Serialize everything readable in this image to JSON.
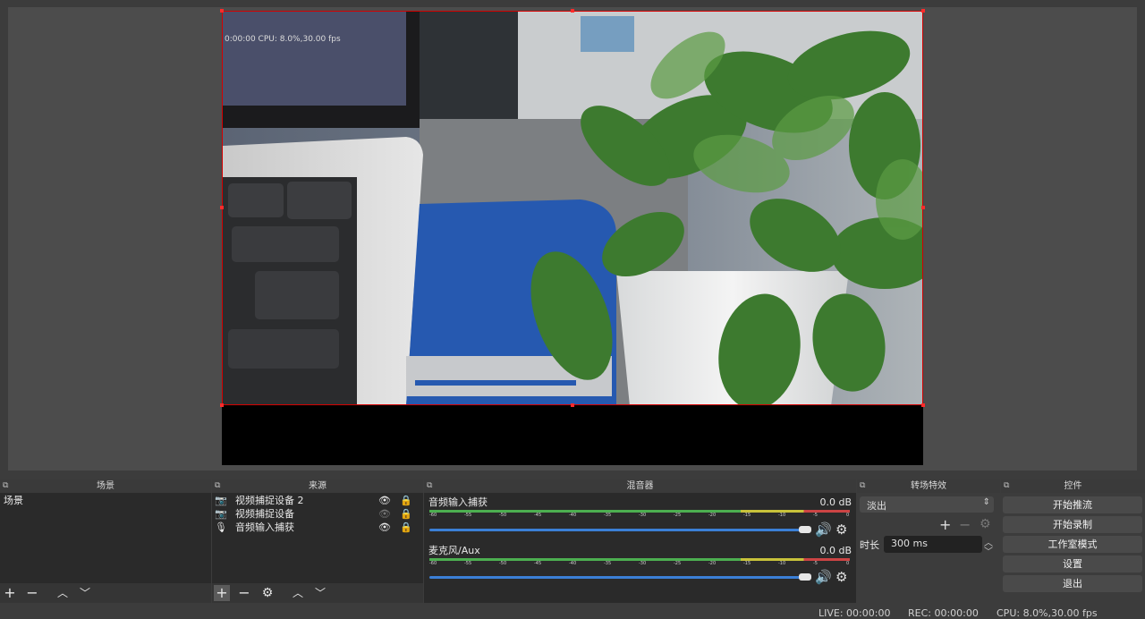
{
  "docks": {
    "scenes": {
      "title": "场景",
      "items": [
        "场景"
      ]
    },
    "sources": {
      "title": "来源",
      "items": [
        {
          "label": "视频捕捉设备 2",
          "icon": "camera-icon",
          "visible": true
        },
        {
          "label": "视频捕捉设备",
          "icon": "camera-icon",
          "visible": false
        },
        {
          "label": "音频输入捕获",
          "icon": "microphone-icon",
          "visible": true
        }
      ]
    },
    "mixer": {
      "title": "混音器",
      "channels": [
        {
          "name": "音频输入捕获",
          "level": "0.0 dB"
        },
        {
          "name": "麦克风/Aux",
          "level": "0.0 dB"
        }
      ],
      "ticks": [
        "-60",
        "-55",
        "-50",
        "-45",
        "-40",
        "-35",
        "-30",
        "-25",
        "-20",
        "-15",
        "-10",
        "-5",
        "0"
      ]
    },
    "transitions": {
      "title": "转场特效",
      "selected": "淡出",
      "duration_label": "时长",
      "duration_value": "300 ms"
    },
    "controls": {
      "title": "控件",
      "buttons": [
        "开始推流",
        "开始录制",
        "工作室模式",
        "设置",
        "退出"
      ]
    }
  },
  "status": {
    "live": "LIVE: 00:00:00",
    "rec": "REC: 00:00:00",
    "cpu": "CPU: 8.0%,30.00 fps"
  },
  "preview": {
    "overlay_text": "0:00:00    CPU: 8.0%,30.00 fps"
  },
  "colors": {
    "accent": "#3b7fd6",
    "selection": "#d40000"
  }
}
